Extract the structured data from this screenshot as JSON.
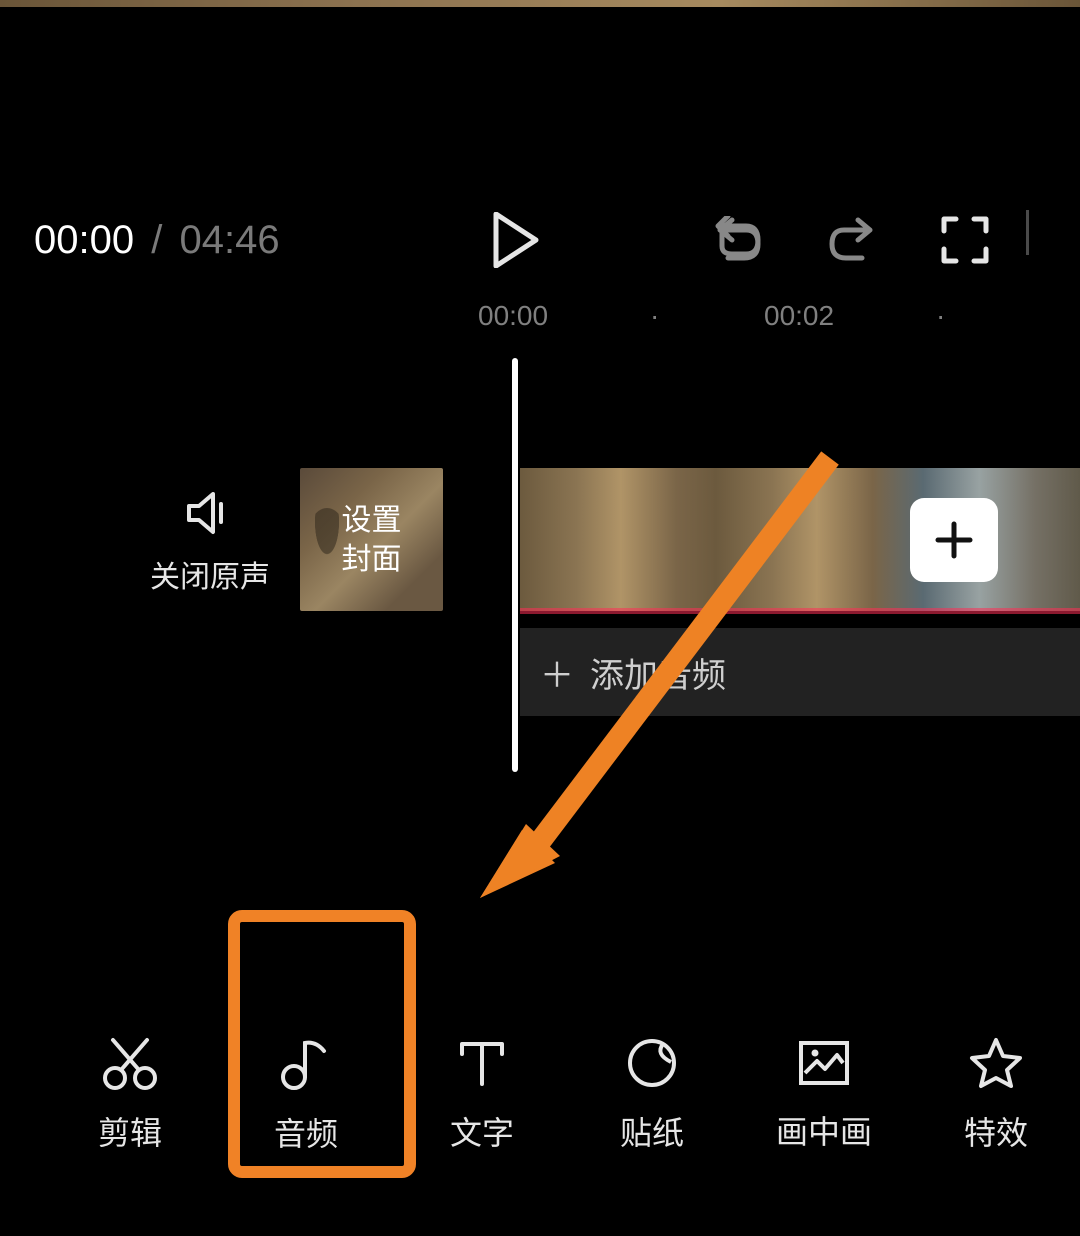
{
  "playback": {
    "current_time": "00:00",
    "separator": "/",
    "total_time": "04:46"
  },
  "ruler": {
    "tick0": "00:00",
    "tick1": "00:02",
    "dot": "·"
  },
  "timeline": {
    "mute_original_label": "关闭原声",
    "set_cover_label": "设置\n封面",
    "add_audio_label": "添加音频"
  },
  "toolbar": {
    "edit": "剪辑",
    "audio": "音频",
    "text": "文字",
    "sticker": "贴纸",
    "pip": "画中画",
    "fx": "特效"
  },
  "icons": {
    "play": "play-icon",
    "undo": "undo-icon",
    "redo": "redo-icon",
    "fullscreen": "fullscreen-icon",
    "speaker": "speaker-icon",
    "plus": "plus-icon",
    "scissors": "scissors-icon",
    "music": "music-note-icon",
    "text": "text-icon",
    "sticker": "sticker-icon",
    "pip": "picture-in-picture-icon",
    "star": "star-icon"
  },
  "colors": {
    "highlight": "#f08226",
    "fg": "#e6e6e6",
    "muted": "#7a7a7a"
  }
}
